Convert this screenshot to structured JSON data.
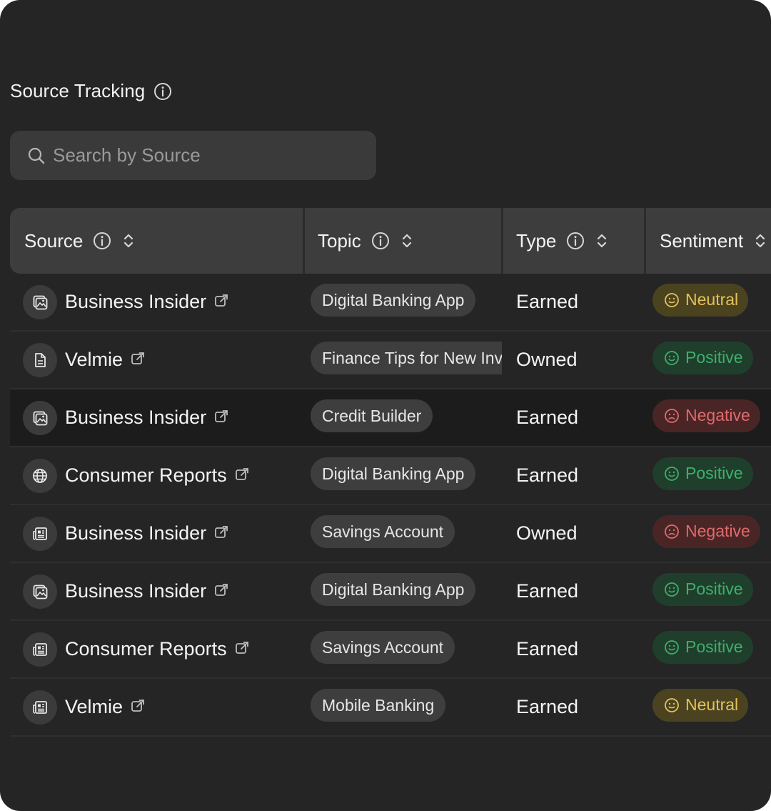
{
  "title": "Source Tracking",
  "search": {
    "placeholder": "Search by Source"
  },
  "columns": [
    {
      "label": "Source"
    },
    {
      "label": "Topic"
    },
    {
      "label": "Type"
    },
    {
      "label": "Sentiment"
    }
  ],
  "colors": {
    "neutral": "#e3c25a",
    "positive": "#3fae6b",
    "negative": "#e06a6a"
  },
  "rows": [
    {
      "icon": "image-icon",
      "source": "Business Insider",
      "topic": "Digital Banking App",
      "type": "Earned",
      "sentiment": "Neutral"
    },
    {
      "icon": "document-icon",
      "source": "Velmie",
      "topic": "Finance Tips for New Investors",
      "type": "Owned",
      "sentiment": "Positive"
    },
    {
      "icon": "image-icon",
      "source": "Business Insider",
      "topic": "Credit Builder",
      "type": "Earned",
      "sentiment": "Negative"
    },
    {
      "icon": "globe-icon",
      "source": "Consumer Reports",
      "topic": "Digital Banking App",
      "type": "Earned",
      "sentiment": "Positive"
    },
    {
      "icon": "newspaper-icon",
      "source": "Business Insider",
      "topic": "Savings Account",
      "type": "Owned",
      "sentiment": "Negative"
    },
    {
      "icon": "image-icon",
      "source": "Business Insider",
      "topic": "Digital Banking App",
      "type": "Earned",
      "sentiment": "Positive"
    },
    {
      "icon": "newspaper-icon",
      "source": "Consumer Reports",
      "topic": "Savings Account",
      "type": "Earned",
      "sentiment": "Positive"
    },
    {
      "icon": "newspaper-icon",
      "source": "Velmie",
      "topic": "Mobile Banking",
      "type": "Earned",
      "sentiment": "Neutral"
    }
  ]
}
